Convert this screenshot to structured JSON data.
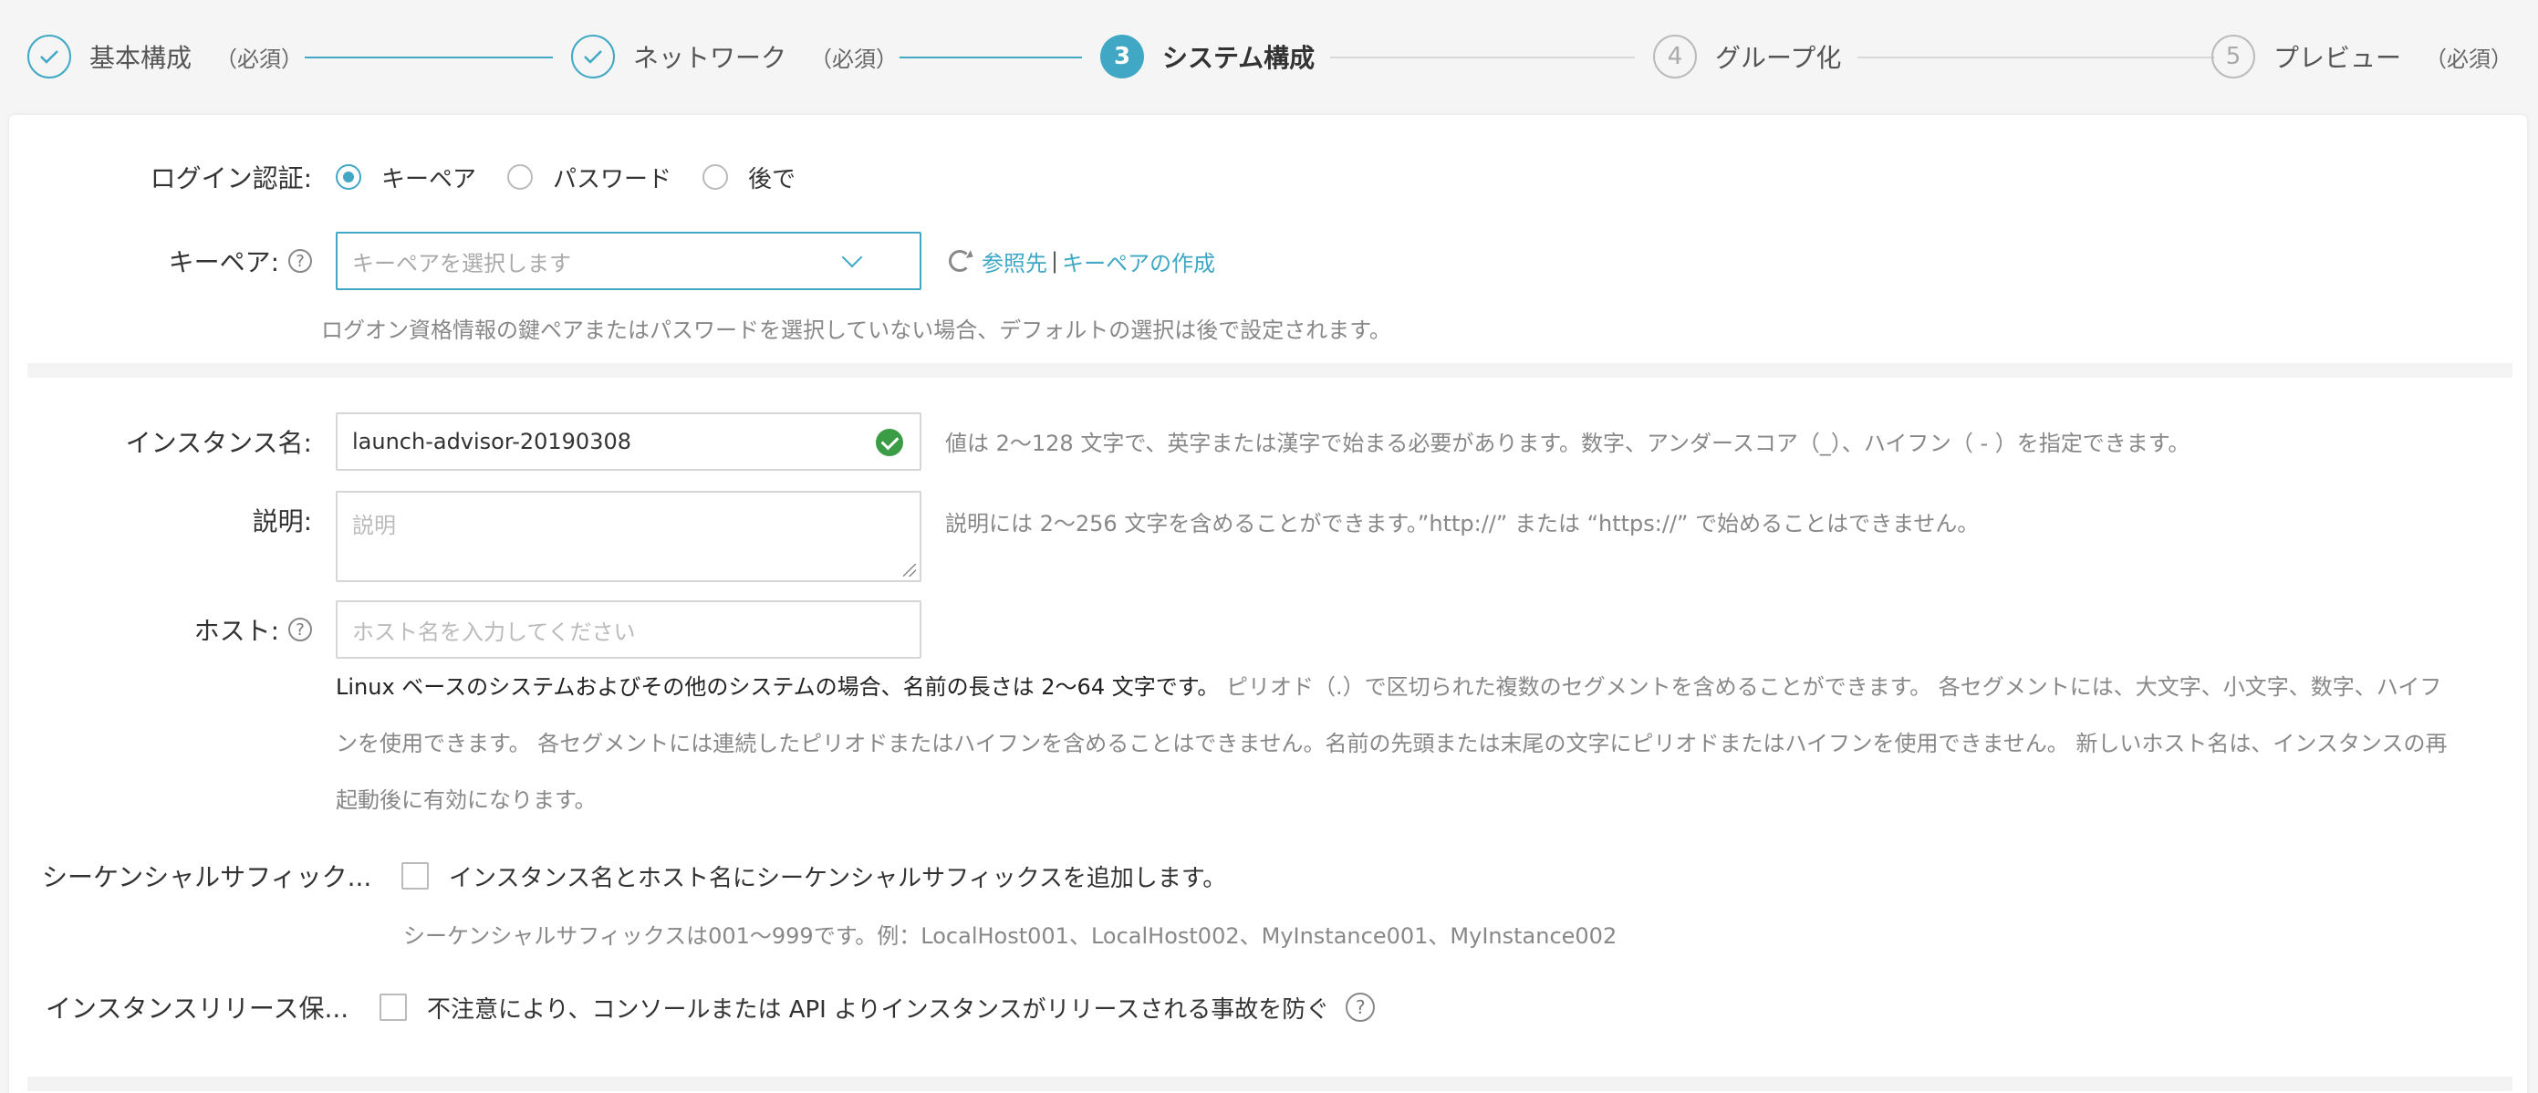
{
  "steps": [
    {
      "label": "基本構成",
      "req": "（必須）",
      "status": "done"
    },
    {
      "label": "ネットワーク",
      "req": "（必須）",
      "status": "done"
    },
    {
      "number": "3",
      "label": "システム構成",
      "status": "active"
    },
    {
      "number": "4",
      "label": "グループ化",
      "status": "todo"
    },
    {
      "number": "5",
      "label": "プレビュー",
      "req": "（必須）",
      "status": "todo"
    }
  ],
  "login": {
    "label": "ログイン認証:",
    "options": [
      "キーペア",
      "パスワード",
      "後で"
    ],
    "selected": "キーペア"
  },
  "keypair": {
    "label": "キーペア:",
    "help": "?",
    "placeholder": "キーペアを選択します",
    "refresh_link": "参照先",
    "separator": "|",
    "create_link": "キーペアの作成",
    "hint": "ログオン資格情報の鍵ペアまたはパスワードを選択していない場合、デフォルトの選択は後で設定されます。"
  },
  "instance_name": {
    "label": "インスタンス名:",
    "value": "launch-advisor-20190308",
    "hint": "値は 2～128 文字で、英字または漢字で始まる必要があります。数字、アンダースコア（_）、ハイフン（ - ）を指定できます。"
  },
  "description": {
    "label": "説明:",
    "placeholder": "説明",
    "hint": "説明には 2～256 文字を含めることができます。”http://” または “https://” で始めることはできません。"
  },
  "host": {
    "label": "ホスト:",
    "help": "?",
    "placeholder": "ホスト名を入力してください",
    "hint_strong": "Linux ベースのシステムおよびその他のシステムの場合、名前の長さは 2～64 文字です。",
    "hint_rest": " ピリオド（.）で区切られた複数のセグメントを含めることができます。 各セグメントには、大文字、小文字、数字、ハイフンを使用できます。 各セグメントには連続したピリオドまたはハイフンを含めることはできません。名前の先頭または末尾の文字にピリオドまたはハイフンを使用できません。 新しいホスト名は、インスタンスの再起動後に有効になります。"
  },
  "sequential_suffix": {
    "label": "シーケンシャルサフィック...",
    "checkbox_label": "インスタンス名とホスト名にシーケンシャルサフィックスを追加します。",
    "hint": "シーケンシャルサフィックスは001～999です。例：LocalHost001、LocalHost002、MyInstance001、MyInstance002"
  },
  "release_protection": {
    "label": "インスタンスリリース保...",
    "checkbox_label": "不注意により、コンソールまたは API よりインスタンスがリリースされる事故を防ぐ",
    "help": "?"
  },
  "colors": {
    "accent": "#40a8c4",
    "success": "#3a9c45"
  }
}
